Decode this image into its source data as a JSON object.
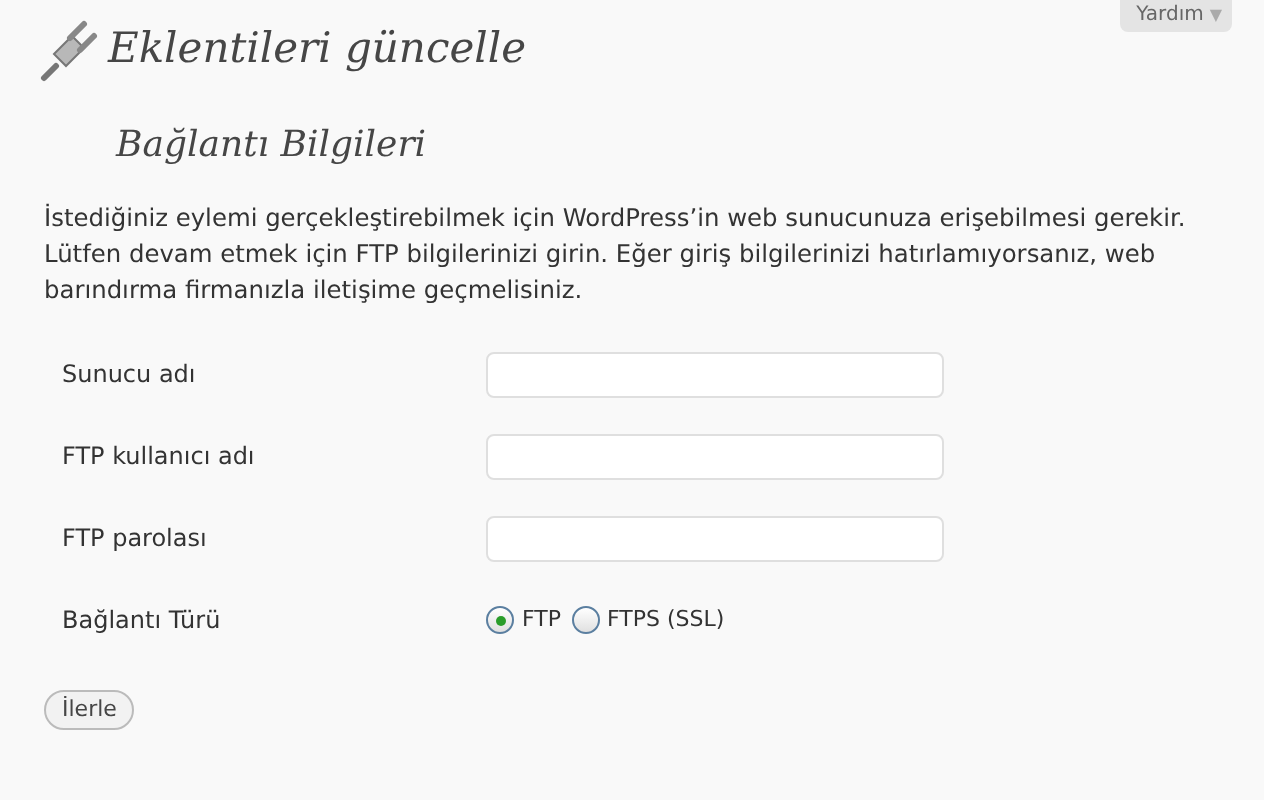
{
  "help_tab": {
    "label": "Yardım",
    "caret": "▼"
  },
  "title": "Eklentileri güncelle",
  "subtitle": "Bağlantı Bilgileri",
  "intro": "İstediğiniz eylemi gerçekleştirebilmek için WordPress’in web sunucunuza erişebilmesi gerekir. Lütfen devam etmek için FTP bilgilerinizi girin. Eğer giriş bilgilerinizi hatırlamıyorsanız, web barındırma firmanızla iletişime geçmelisiniz.",
  "fields": [
    {
      "kind": "text",
      "label": "Sunucu adı"
    },
    {
      "kind": "text",
      "label": "FTP kullanıcı adı"
    },
    {
      "kind": "password",
      "label": "FTP parolası"
    },
    {
      "kind": "radio",
      "label": "Bağlantı Türü",
      "options": [
        {
          "label": "FTP",
          "selected": true
        },
        {
          "label": "FTPS (SSL)",
          "selected": false
        }
      ]
    }
  ],
  "submit": "İlerle"
}
